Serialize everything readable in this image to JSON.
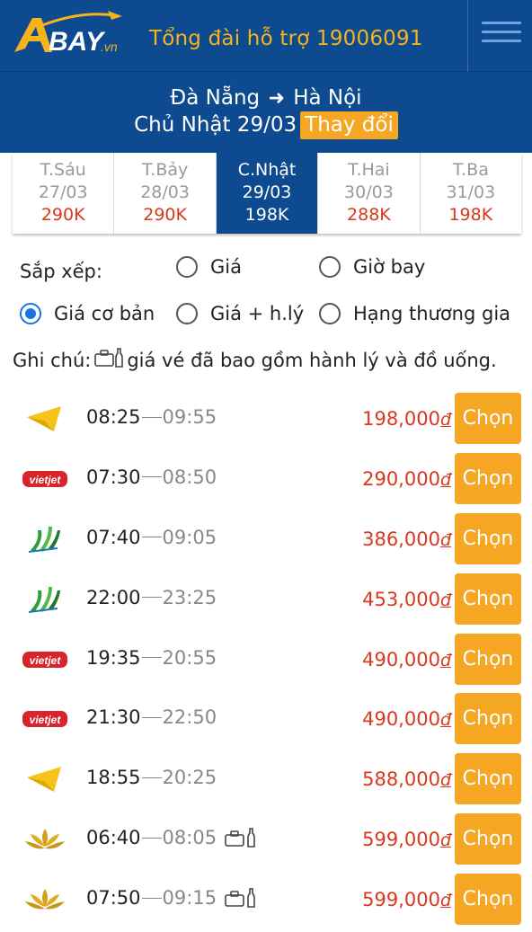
{
  "header": {
    "logo_text": "BAY",
    "logo_suffix": ".vn",
    "hotline": "Tổng đài hỗ trợ 19006091",
    "menu_icon": "hamburger-icon"
  },
  "route": {
    "from": "Đà Nẵng",
    "to": "Hà Nội",
    "date": "Chủ Nhật 29/03",
    "change_label": "Thay đổi"
  },
  "date_tabs": [
    {
      "day": "T.Sáu",
      "date": "27/03",
      "price": "290K",
      "active": false
    },
    {
      "day": "T.Bảy",
      "date": "28/03",
      "price": "290K",
      "active": false
    },
    {
      "day": "C.Nhật",
      "date": "29/03",
      "price": "198K",
      "active": true
    },
    {
      "day": "T.Hai",
      "date": "30/03",
      "price": "288K",
      "active": false
    },
    {
      "day": "T.Ba",
      "date": "31/03",
      "price": "198K",
      "active": false
    }
  ],
  "sort": {
    "label": "Sắp xếp:",
    "options": [
      {
        "label": "Giá",
        "selected": false
      },
      {
        "label": "Giờ bay",
        "selected": false
      },
      {
        "label": "Giá cơ bản",
        "selected": true
      },
      {
        "label": "Giá + h.lý",
        "selected": false
      },
      {
        "label": "Hạng thương gia",
        "selected": false
      }
    ]
  },
  "note": {
    "prefix": "Ghi chú:",
    "text": "giá vé đã bao gồm hành lý và đồ uống."
  },
  "colors": {
    "primary": "#0e4a8f",
    "accent": "#f5a623",
    "price": "#d9381e",
    "radio_active": "#1a73e8"
  },
  "flights": [
    {
      "airline": "jetstar",
      "dep": "08:25",
      "arr": "09:55",
      "price": "198,000",
      "currency": "đ",
      "extras": false,
      "button": "Chọn"
    },
    {
      "airline": "vietjet",
      "dep": "07:30",
      "arr": "08:50",
      "price": "290,000",
      "currency": "đ",
      "extras": false,
      "button": "Chọn"
    },
    {
      "airline": "bamboo",
      "dep": "07:40",
      "arr": "09:05",
      "price": "386,000",
      "currency": "đ",
      "extras": false,
      "button": "Chọn"
    },
    {
      "airline": "bamboo",
      "dep": "22:00",
      "arr": "23:25",
      "price": "453,000",
      "currency": "đ",
      "extras": false,
      "button": "Chọn"
    },
    {
      "airline": "vietjet",
      "dep": "19:35",
      "arr": "20:55",
      "price": "490,000",
      "currency": "đ",
      "extras": false,
      "button": "Chọn"
    },
    {
      "airline": "vietjet",
      "dep": "21:30",
      "arr": "22:50",
      "price": "490,000",
      "currency": "đ",
      "extras": false,
      "button": "Chọn"
    },
    {
      "airline": "jetstar",
      "dep": "18:55",
      "arr": "20:25",
      "price": "588,000",
      "currency": "đ",
      "extras": false,
      "button": "Chọn"
    },
    {
      "airline": "vietnam-airlines",
      "dep": "06:40",
      "arr": "08:05",
      "price": "599,000",
      "currency": "đ",
      "extras": true,
      "button": "Chọn"
    },
    {
      "airline": "vietnam-airlines",
      "dep": "07:50",
      "arr": "09:15",
      "price": "599,000",
      "currency": "đ",
      "extras": true,
      "button": "Chọn"
    }
  ]
}
